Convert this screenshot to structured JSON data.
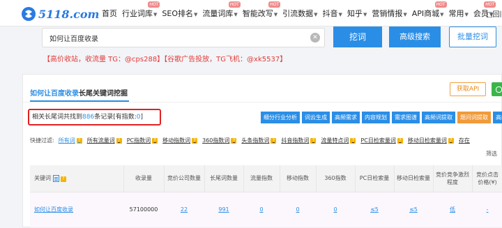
{
  "nav": {
    "logo": "5118.com",
    "items": [
      {
        "label": "首页",
        "caret": false,
        "hot": false
      },
      {
        "label": "行业词库",
        "caret": true,
        "hot": true
      },
      {
        "label": "SEO排名",
        "caret": true,
        "hot": false
      },
      {
        "label": "流量词库",
        "caret": true,
        "hot": true
      },
      {
        "label": "智能改写",
        "caret": true,
        "hot": true
      },
      {
        "label": "引流数据",
        "caret": true,
        "hot": false
      },
      {
        "label": "抖音",
        "caret": true,
        "hot": false
      },
      {
        "label": "知乎",
        "caret": true,
        "hot": false
      },
      {
        "label": "营销情报",
        "caret": true,
        "hot": false
      },
      {
        "label": "API商城",
        "caret": true,
        "hot": true
      },
      {
        "label": "常用",
        "caret": true,
        "hot": false
      },
      {
        "label": "会员",
        "caret": true,
        "hot": true
      }
    ],
    "hot_label": "HOT",
    "extra": "□回旧"
  },
  "search": {
    "value": "如何让百度收录",
    "placeholder": "",
    "dig_button": "挖词",
    "advanced_button": "高级搜索",
    "batch_button": "批量挖词"
  },
  "ads": "【高价收站，收流量 TG：@cps288】【谷歌广告投放，TG飞机：@xk5537】",
  "panel": {
    "title_keyword": "如何让百度收录",
    "title_suffix": "长尾关键词挖掘",
    "api_button": "获取API",
    "records_prefix": "相关长尾词共找到",
    "records_count": "886",
    "records_middle": "条记录[有指数:",
    "records_index": "0",
    "records_suffix": "]",
    "actions": [
      {
        "label": "细分行业分析",
        "style": "blue"
      },
      {
        "label": "词云生成",
        "style": "blue"
      },
      {
        "label": "高频需求",
        "style": "blue"
      },
      {
        "label": "内容规划",
        "style": "blue"
      },
      {
        "label": "需求图谱",
        "style": "blue"
      },
      {
        "label": "高频词提取",
        "style": "blue"
      },
      {
        "label": "题问词提取",
        "style": "orange"
      },
      {
        "label": "高频",
        "style": "blue"
      }
    ],
    "filter_label": "快捷过滤:",
    "filters": [
      {
        "label": "所有词",
        "q": true,
        "active": true
      },
      {
        "label": "所有流量词",
        "q": true,
        "active": false
      },
      {
        "label": "PC指数词",
        "q": true,
        "active": false
      },
      {
        "label": "移动指数词",
        "q": true,
        "active": false
      },
      {
        "label": "360指数词",
        "q": true,
        "active": false
      },
      {
        "label": "头条指数词",
        "q": true,
        "active": false
      },
      {
        "label": "抖音指数词",
        "q": true,
        "active": false
      },
      {
        "label": "流量特点词",
        "q": true,
        "active": false
      },
      {
        "label": "PC日检索量词",
        "q": true,
        "active": false
      },
      {
        "label": "移动日检索量词",
        "q": true,
        "active": false
      },
      {
        "label": "存在",
        "q": false,
        "active": false
      }
    ],
    "filter_more": "筛选",
    "columns": [
      "关键词",
      "收录量",
      "竞价公司数量",
      "长尾词数量",
      "流量指数",
      "移动指数",
      "360指数",
      "PC日检索量",
      "移动日检索量",
      "竞价竞争激烈程度",
      "竞价点击价格(¥)"
    ],
    "rows": [
      {
        "keyword": "如何让百度收录",
        "indexed": "57100000",
        "bid_companies": "22",
        "longtail": "991",
        "traffic_index": "0",
        "mobile_index": "0",
        "index_360": "0",
        "pc_daily": "≤5",
        "mobile_daily": "≤5",
        "competition": "低",
        "click_price": "-"
      }
    ]
  }
}
